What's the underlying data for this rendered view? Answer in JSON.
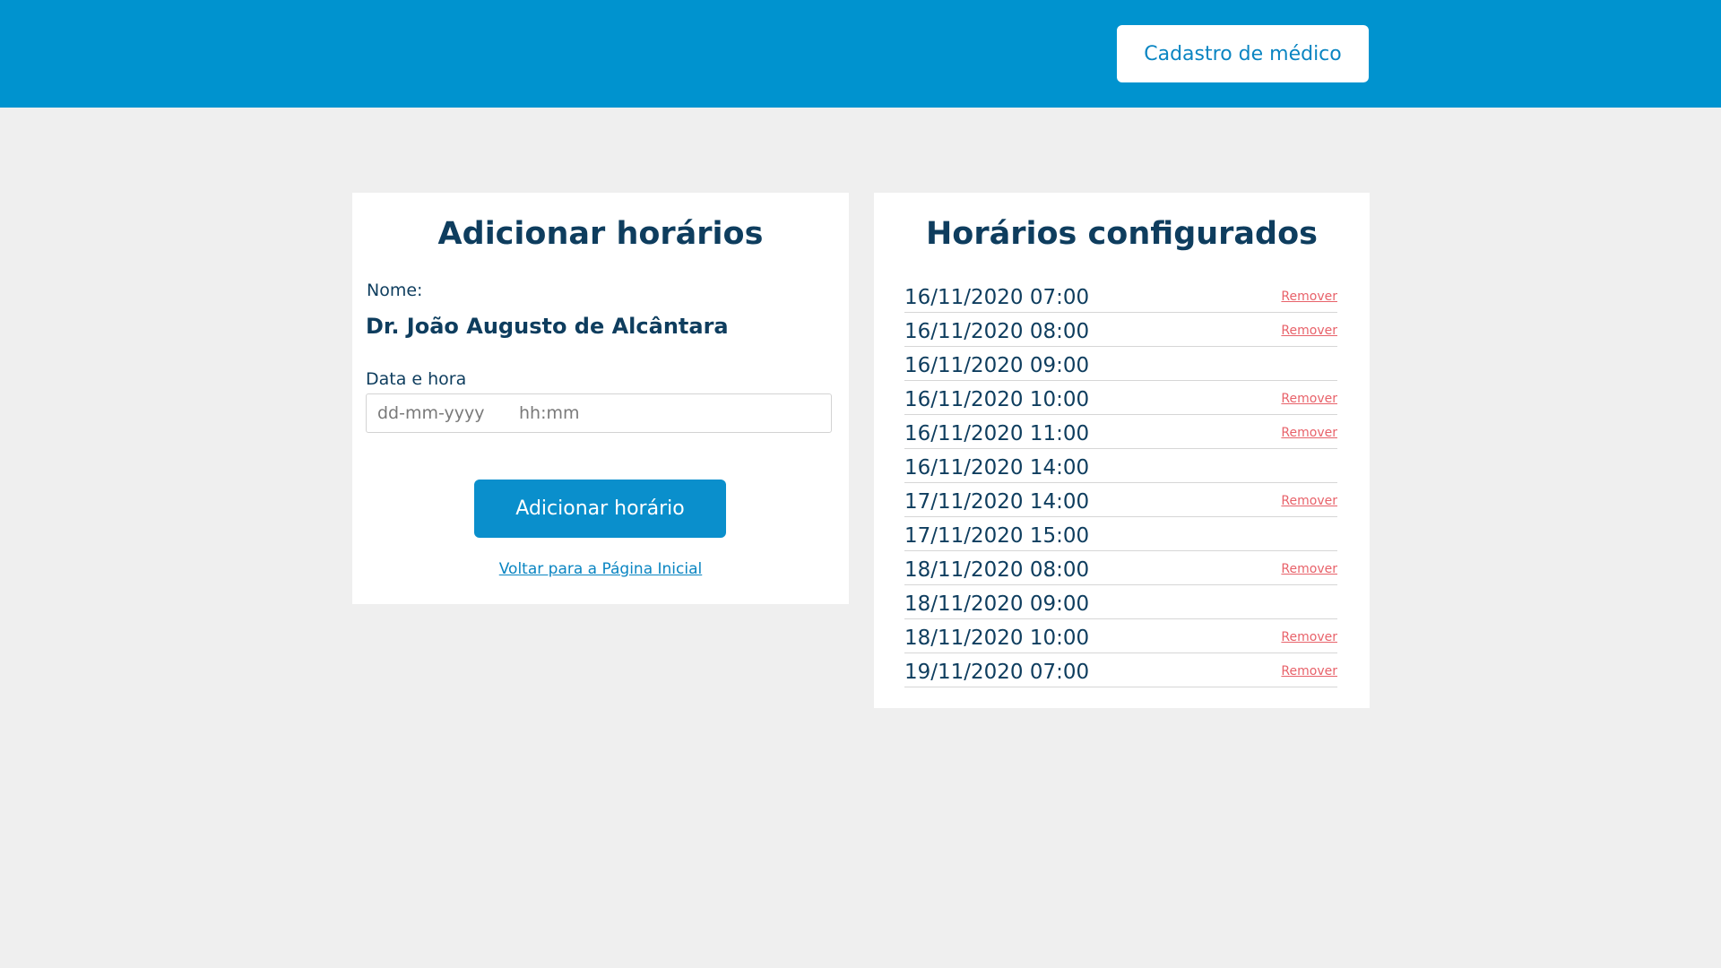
{
  "header": {
    "button_label": "Cadastro de médico",
    "background_color": "#0093cf"
  },
  "add_card": {
    "title": "Adicionar horários",
    "name_label": "Nome:",
    "doctor_name": "Dr. João Augusto de Alcântara",
    "datetime_label": "Data e hora",
    "date_placeholder": "dd-mm-yyyy",
    "time_placeholder": "hh:mm",
    "add_button_label": "Adicionar horário",
    "back_link_label": "Voltar para a Página Inicial"
  },
  "schedule_card": {
    "title": "Horários configurados",
    "remove_label": "Remover",
    "items": [
      {
        "time": "16/11/2020 07:00",
        "removable": true
      },
      {
        "time": "16/11/2020 08:00",
        "removable": true
      },
      {
        "time": "16/11/2020 09:00",
        "removable": false
      },
      {
        "time": "16/11/2020 10:00",
        "removable": true
      },
      {
        "time": "16/11/2020 11:00",
        "removable": true
      },
      {
        "time": "16/11/2020 14:00",
        "removable": false
      },
      {
        "time": "17/11/2020 14:00",
        "removable": true
      },
      {
        "time": "17/11/2020 15:00",
        "removable": false
      },
      {
        "time": "18/11/2020 08:00",
        "removable": true
      },
      {
        "time": "18/11/2020 09:00",
        "removable": false
      },
      {
        "time": "18/11/2020 10:00",
        "removable": true
      },
      {
        "time": "19/11/2020 07:00",
        "removable": true
      }
    ]
  },
  "colors": {
    "primary": "#0093cf",
    "text_dark": "#0e3d5e",
    "remove_red": "#e8626a",
    "page_bg": "#efefef"
  }
}
